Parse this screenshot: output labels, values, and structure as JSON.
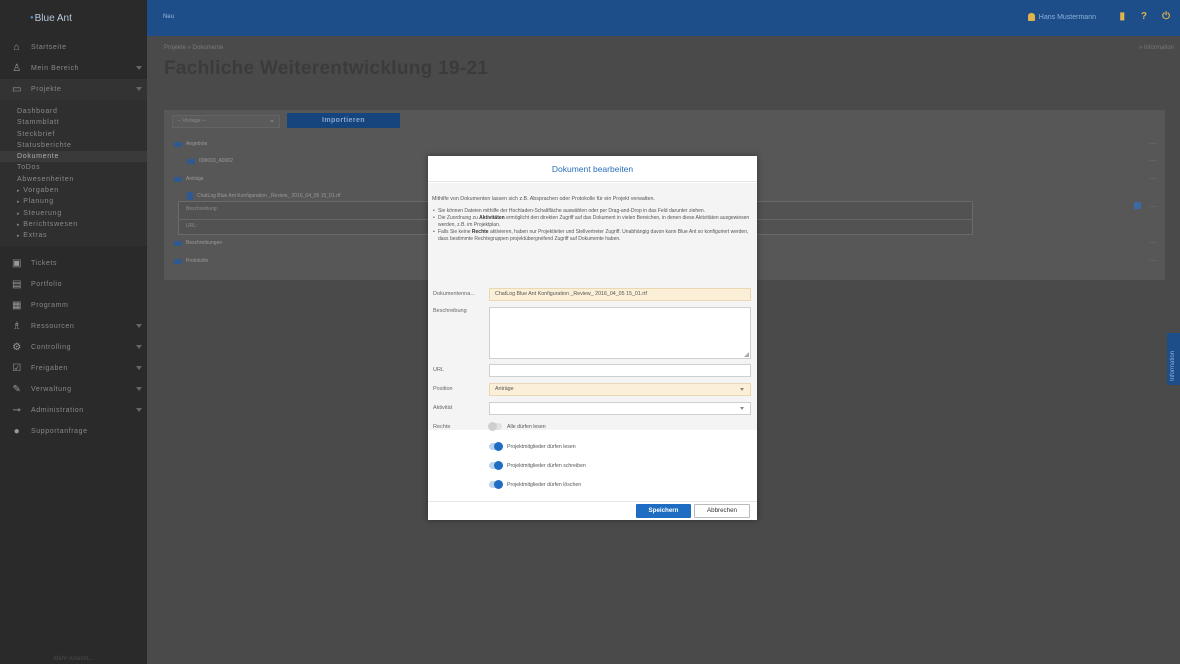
{
  "app": {
    "logo_text": "Blue Ant"
  },
  "topbar": {
    "new_label": "Neu",
    "user_name": "Hans Mustermann",
    "help_icon_text": "?"
  },
  "sidebar": {
    "items": [
      {
        "label": "Startseite",
        "icon": "home-icon"
      },
      {
        "label": "Mein Bereich",
        "icon": "person-icon"
      },
      {
        "label": "Projekte",
        "icon": "folder-icon"
      },
      {
        "label": "Tickets",
        "icon": "ticket-icon"
      },
      {
        "label": "Portfolio",
        "icon": "portfolio-icon"
      },
      {
        "label": "Programm",
        "icon": "program-icon"
      },
      {
        "label": "Ressourcen",
        "icon": "resources-icon"
      },
      {
        "label": "Controlling",
        "icon": "controlling-icon"
      },
      {
        "label": "Freigaben",
        "icon": "approval-icon"
      },
      {
        "label": "Verwaltung",
        "icon": "admin-icon"
      },
      {
        "label": "Administration",
        "icon": "key-icon"
      },
      {
        "label": "Supportanfrage",
        "icon": "support-icon"
      }
    ],
    "projekte_sub": [
      "Dashboard",
      "Stammblatt",
      "Steckbrief",
      "Statusberichte",
      "Dokumente",
      "ToDos",
      "Abwesenheiten",
      "Vorgaben",
      "Planung",
      "Steuerung",
      "Berichtswesen",
      "Extras"
    ],
    "footer": "Mehr Ansicht..."
  },
  "main": {
    "breadcrumb": "Projekte  »  Dokumente",
    "info_link": "» Information",
    "title": "Fachliche Weiterentwicklung 19-21",
    "vorlage_placeholder": "-- Vorlage --",
    "import_label": "Importieren",
    "tree": {
      "angebote": "Angebote",
      "angebote_child": "000000_A0002",
      "antraege": "Anträge",
      "file": "ChatLog Blue Ant Konfiguration _Review_ 2016_04_05 15_01.rtf",
      "beschreibung_label": "Beschreibung:",
      "url_label": "URL:",
      "beschreibungen": "Beschreibungen",
      "protokolle": "Protokolle",
      "more": "..."
    },
    "info_tab": "Information"
  },
  "dialog": {
    "title": "Dokument bearbeiten",
    "intro_lead_a": "Mithilfe von Dokumenten lassen sich z.B. Absprachen oder Protokolle für ein Projekt verwalten.",
    "bullet1": "Sie können Dateien mithilfe der Hochladen-Schaltfläche auswählen oder per Drag-and-Drop in das Feld darunter ziehen.",
    "bullet2_a": "Die Zuordnung zu ",
    "bullet2_b": "Aktivitäten",
    "bullet2_c": " ermöglicht den direkten Zugriff auf das Dokument in vielen Bereichen, in denen diese Aktivitäten ausgewiesen werden, z.B. im Projektplan.",
    "bullet3_a": "Falls Sie keine ",
    "bullet3_b": "Rechte",
    "bullet3_c": " aktivieren, haben nur Projektleiter und Stellvertreter Zugriff. Unabhängig davon kann Blue Ant so konfiguriert werden, dass bestimmte Rechtegruppen projektübergreifend Zugriff auf Dokumente haben.",
    "fields": {
      "name_label": "Dokumentenna...",
      "name_value": "ChatLog Blue Ant Konfiguration _Review_ 2016_04_05 15_01.rtf",
      "beschreibung_label": "Beschreibung",
      "url_label": "URL",
      "position_label": "Position",
      "position_value": "Anträge",
      "aktivitaet_label": "Aktivität",
      "rechte_label": "Rechte"
    },
    "rights": [
      {
        "label": "Alle dürfen lesen",
        "on": false
      },
      {
        "label": "Projektmitglieder dürfen lesen",
        "on": true
      },
      {
        "label": "Projektmitglieder dürfen schreiben",
        "on": true
      },
      {
        "label": "Projektmitglieder dürfen löschen",
        "on": true
      }
    ],
    "save_label": "Speichern",
    "cancel_label": "Abbrechen"
  }
}
